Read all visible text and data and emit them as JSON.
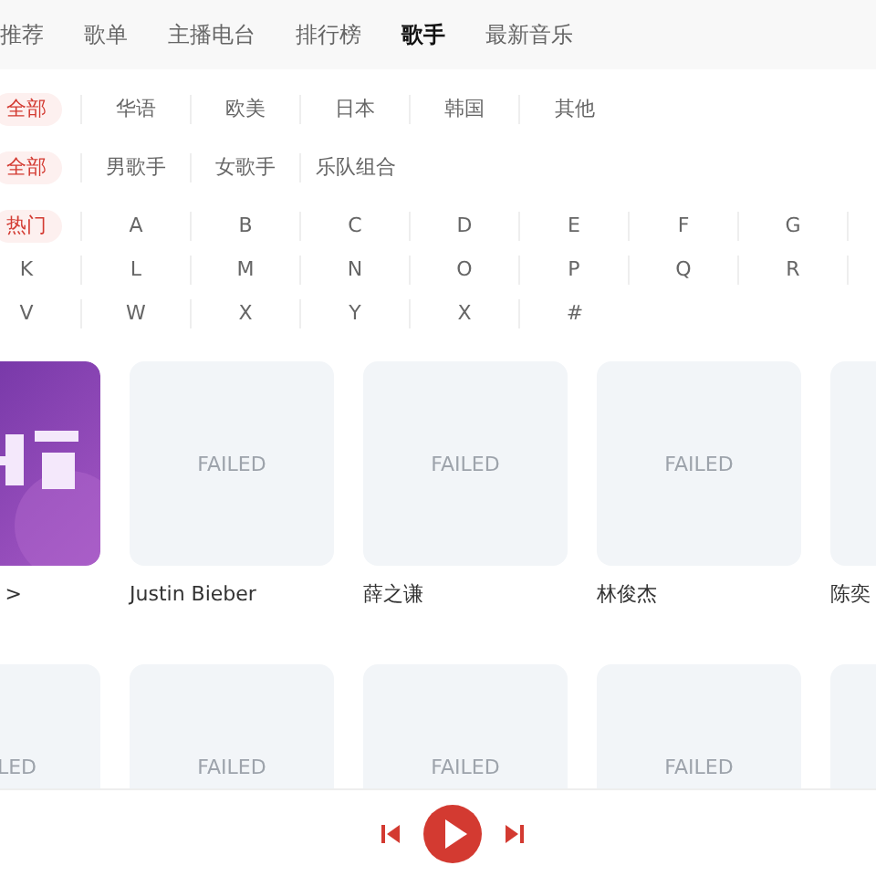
{
  "tabs": [
    {
      "label": "推荐",
      "selected": false
    },
    {
      "label": "歌单",
      "selected": false
    },
    {
      "label": "主播电台",
      "selected": false
    },
    {
      "label": "排行榜",
      "selected": false
    },
    {
      "label": "歌手",
      "selected": true
    },
    {
      "label": "最新音乐",
      "selected": false
    }
  ],
  "filters": [
    {
      "options": [
        {
          "label": "全部",
          "selected": true
        },
        {
          "label": "华语",
          "selected": false
        },
        {
          "label": "欧美",
          "selected": false
        },
        {
          "label": "日本",
          "selected": false
        },
        {
          "label": "韩国",
          "selected": false
        },
        {
          "label": "其他",
          "selected": false
        }
      ]
    },
    {
      "options": [
        {
          "label": "全部",
          "selected": true
        },
        {
          "label": "男歌手",
          "selected": false
        },
        {
          "label": "女歌手",
          "selected": false
        },
        {
          "label": "乐队组合",
          "selected": false
        }
      ]
    },
    {
      "options": [
        {
          "label": "热门",
          "selected": true
        },
        {
          "label": "A",
          "selected": false
        },
        {
          "label": "B",
          "selected": false
        },
        {
          "label": "C",
          "selected": false
        },
        {
          "label": "D",
          "selected": false
        },
        {
          "label": "E",
          "selected": false
        },
        {
          "label": "F",
          "selected": false
        },
        {
          "label": "G",
          "selected": false
        },
        {
          "label": "K",
          "selected": false
        },
        {
          "label": "L",
          "selected": false
        },
        {
          "label": "M",
          "selected": false
        },
        {
          "label": "N",
          "selected": false
        },
        {
          "label": "O",
          "selected": false
        },
        {
          "label": "P",
          "selected": false
        },
        {
          "label": "Q",
          "selected": false
        },
        {
          "label": "R",
          "selected": false
        },
        {
          "label": "V",
          "selected": false
        },
        {
          "label": "W",
          "selected": false
        },
        {
          "label": "X",
          "selected": false
        },
        {
          "label": "Y",
          "selected": false
        },
        {
          "label": "X",
          "selected": false
        },
        {
          "label": "#",
          "selected": false
        }
      ]
    }
  ],
  "artist_rows": [
    [
      {
        "kind": "chart",
        "name": ">"
      },
      {
        "kind": "failed",
        "image_text": "FAILED",
        "name": "Justin Bieber"
      },
      {
        "kind": "failed",
        "image_text": "FAILED",
        "name": "薛之谦"
      },
      {
        "kind": "failed",
        "image_text": "FAILED",
        "name": "林俊杰"
      },
      {
        "kind": "failed",
        "name": "陈奕"
      }
    ],
    [
      {
        "kind": "failed",
        "image_text": "LED"
      },
      {
        "kind": "failed",
        "image_text": "FAILED"
      },
      {
        "kind": "failed",
        "image_text": "FAILED"
      },
      {
        "kind": "failed",
        "image_text": "FAILED"
      },
      {
        "kind": "failed"
      }
    ]
  ],
  "player": {
    "playing": false
  }
}
